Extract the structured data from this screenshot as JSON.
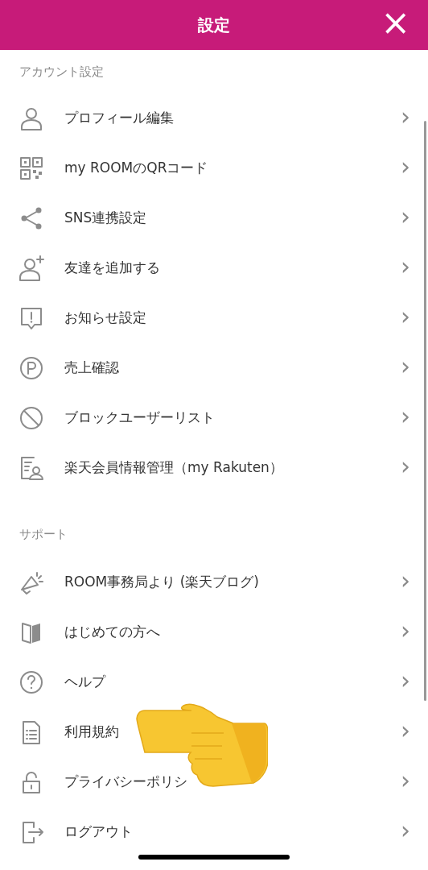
{
  "header": {
    "title": "設定",
    "close": "×"
  },
  "sections": [
    {
      "title": "アカウント設定",
      "items": [
        {
          "kind": "person",
          "label": "プロフィール編集",
          "chevron": "›"
        },
        {
          "kind": "qr",
          "label": "my ROOMのQRコード",
          "chevron": "›"
        },
        {
          "kind": "share",
          "label": "SNS連携設定",
          "chevron": "›"
        },
        {
          "kind": "addperson",
          "label": "友達を追加する",
          "chevron": "›"
        },
        {
          "kind": "notice",
          "label": "お知らせ設定",
          "chevron": "›"
        },
        {
          "kind": "points",
          "label": "売上確認",
          "chevron": "›"
        },
        {
          "kind": "block",
          "label": "ブロックユーザーリスト",
          "chevron": "›"
        },
        {
          "kind": "member",
          "label": "楽天会員情報管理（my Rakuten）",
          "chevron": "›"
        }
      ]
    },
    {
      "title": "サポート",
      "items": [
        {
          "kind": "megaphone",
          "label": "ROOM事務局より (楽天ブログ)",
          "chevron": "›"
        },
        {
          "kind": "book",
          "label": "はじめての方へ",
          "chevron": "›"
        },
        {
          "kind": "help",
          "label": "ヘルプ",
          "chevron": "›"
        },
        {
          "kind": "document",
          "label": "利用規約",
          "chevron": "›"
        },
        {
          "kind": "lock",
          "label": "プライバシーポリシ",
          "chevron": "›"
        },
        {
          "kind": "logout",
          "label": "ログアウト",
          "chevron": "›"
        }
      ]
    }
  ]
}
